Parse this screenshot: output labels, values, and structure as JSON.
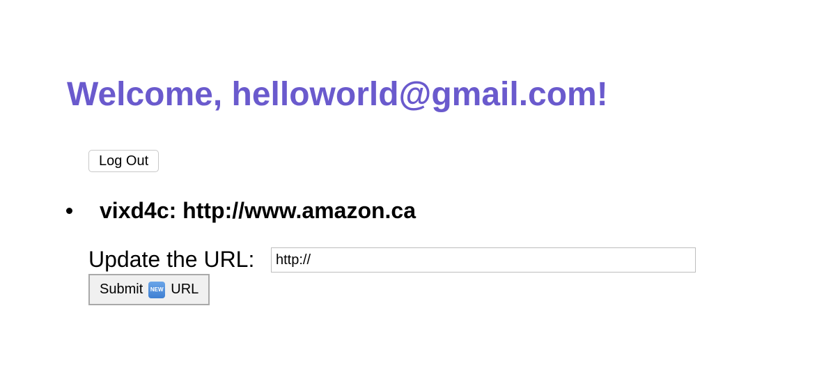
{
  "header": {
    "welcome_text": "Welcome, helloworld@gmail.com!"
  },
  "auth": {
    "logout_label": "Log Out"
  },
  "urls": [
    {
      "short_id": "vixd4c",
      "long_url": "http://www.amazon.ca",
      "display": "vixd4c: http://www.amazon.ca"
    }
  ],
  "update_form": {
    "label": "Update the URL:",
    "input_value": "http://",
    "submit_prefix": "Submit",
    "submit_icon": "new-emoji-icon",
    "submit_icon_text": "NEW",
    "submit_suffix": "URL"
  },
  "colors": {
    "welcome": "#6a5acd"
  }
}
